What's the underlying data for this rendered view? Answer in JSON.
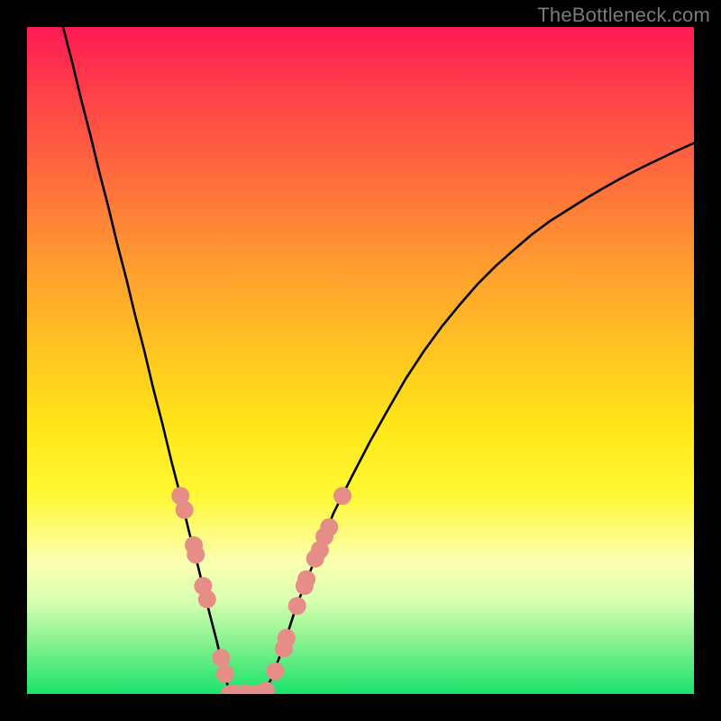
{
  "watermark": "TheBottleneck.com",
  "colors": {
    "frame": "#000000",
    "curve": "#000000",
    "marker_fill": "#e78d88",
    "marker_stroke": "#d46e68"
  },
  "chart_data": {
    "type": "line",
    "title": "",
    "xlabel": "",
    "ylabel": "",
    "xlim": [
      0,
      100
    ],
    "ylim": [
      0,
      100
    ],
    "grid": false,
    "legend": false,
    "curve_samples_xy": [
      [
        5.4,
        100.0
      ],
      [
        6.8,
        94.6
      ],
      [
        8.1,
        89.2
      ],
      [
        9.5,
        83.8
      ],
      [
        10.8,
        78.4
      ],
      [
        12.2,
        73.0
      ],
      [
        13.5,
        67.6
      ],
      [
        14.9,
        62.2
      ],
      [
        16.2,
        56.8
      ],
      [
        17.6,
        51.4
      ],
      [
        18.9,
        45.9
      ],
      [
        20.3,
        40.5
      ],
      [
        21.6,
        35.1
      ],
      [
        23.0,
        29.7
      ],
      [
        24.3,
        24.3
      ],
      [
        25.7,
        18.9
      ],
      [
        27.0,
        13.5
      ],
      [
        28.4,
        8.1
      ],
      [
        29.7,
        2.7
      ],
      [
        30.4,
        0.0
      ],
      [
        31.1,
        0.0
      ],
      [
        32.4,
        0.0
      ],
      [
        33.8,
        0.0
      ],
      [
        35.1,
        0.0
      ],
      [
        36.5,
        2.0
      ],
      [
        37.8,
        5.4
      ],
      [
        39.2,
        9.5
      ],
      [
        40.5,
        13.5
      ],
      [
        41.9,
        16.9
      ],
      [
        43.2,
        20.3
      ],
      [
        44.6,
        23.6
      ],
      [
        45.9,
        27.0
      ],
      [
        48.6,
        32.4
      ],
      [
        51.4,
        37.8
      ],
      [
        54.1,
        42.6
      ],
      [
        56.8,
        47.3
      ],
      [
        59.5,
        51.4
      ],
      [
        62.2,
        55.1
      ],
      [
        64.9,
        58.4
      ],
      [
        67.6,
        61.5
      ],
      [
        70.3,
        64.2
      ],
      [
        73.0,
        66.6
      ],
      [
        75.7,
        68.9
      ],
      [
        78.4,
        70.9
      ],
      [
        81.1,
        72.6
      ],
      [
        83.8,
        74.3
      ],
      [
        86.5,
        75.9
      ],
      [
        89.2,
        77.4
      ],
      [
        91.9,
        78.8
      ],
      [
        94.6,
        80.1
      ],
      [
        97.3,
        81.4
      ],
      [
        100.0,
        82.6
      ]
    ],
    "markers_xy": [
      [
        23.0,
        29.7
      ],
      [
        23.6,
        27.6
      ],
      [
        25.0,
        22.3
      ],
      [
        25.3,
        20.9
      ],
      [
        26.4,
        16.2
      ],
      [
        27.0,
        14.2
      ],
      [
        29.1,
        5.4
      ],
      [
        29.7,
        3.0
      ],
      [
        30.4,
        0.0
      ],
      [
        31.1,
        0.0
      ],
      [
        32.4,
        0.0
      ],
      [
        33.1,
        0.0
      ],
      [
        34.5,
        0.0
      ],
      [
        35.1,
        0.0
      ],
      [
        35.8,
        0.5
      ],
      [
        37.2,
        3.4
      ],
      [
        38.5,
        6.8
      ],
      [
        38.9,
        8.4
      ],
      [
        40.5,
        13.2
      ],
      [
        41.6,
        16.2
      ],
      [
        41.9,
        17.2
      ],
      [
        43.2,
        20.3
      ],
      [
        43.9,
        21.6
      ],
      [
        44.6,
        23.6
      ],
      [
        45.3,
        25.0
      ],
      [
        47.3,
        29.7
      ]
    ]
  }
}
